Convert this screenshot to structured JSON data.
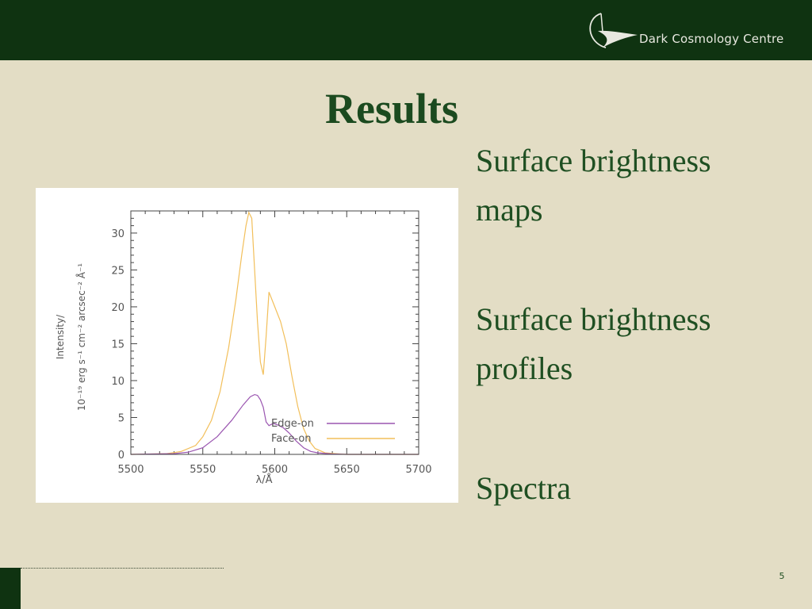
{
  "header": {
    "brand": "Dark Cosmology Centre",
    "logo_icon": "dark-cosmology-logo-icon"
  },
  "slide": {
    "title": "Results",
    "bullets": [
      {
        "line1": "Surface brightness",
        "line2": "maps"
      },
      {
        "line1": "Surface brightness",
        "line2": "profiles"
      },
      {
        "line1": "Spectra",
        "line2": ""
      }
    ],
    "page_number": "5"
  },
  "colors": {
    "header_bg": "#0f3311",
    "background": "#e3ddc5",
    "text": "#1f4f22",
    "edge_on": "#9a55b0",
    "face_on": "#f2bf5a"
  },
  "chart_data": {
    "type": "line",
    "xlabel": "λ/Å",
    "ylabel_line1": "Intensity/",
    "ylabel_line2": "10⁻¹⁹ erg s⁻¹ cm⁻² arcsec⁻² Å⁻¹",
    "xlim": [
      5500,
      5700
    ],
    "ylim": [
      0,
      33
    ],
    "xticks": [
      5500,
      5550,
      5600,
      5650,
      5700
    ],
    "yticks": [
      0,
      5,
      10,
      15,
      20,
      25,
      30
    ],
    "legend_position": "top-right",
    "series": [
      {
        "name": "Edge-on",
        "color": "#9a55b0",
        "x": [
          5500,
          5530,
          5540,
          5550,
          5560,
          5570,
          5578,
          5583,
          5586,
          5588,
          5590,
          5592,
          5594,
          5596,
          5599,
          5602,
          5606,
          5610,
          5615,
          5620,
          5625,
          5630,
          5640,
          5650,
          5700
        ],
        "y": [
          0,
          0.1,
          0.3,
          0.9,
          2.4,
          4.6,
          6.7,
          7.8,
          8.1,
          8.0,
          7.4,
          6.4,
          4.4,
          3.9,
          4.2,
          4.0,
          3.6,
          2.9,
          1.8,
          0.9,
          0.4,
          0.2,
          0.05,
          0,
          0
        ]
      },
      {
        "name": "Face-on",
        "color": "#f2bf5a",
        "x": [
          5500,
          5525,
          5535,
          5545,
          5550,
          5556,
          5562,
          5568,
          5573,
          5577,
          5580,
          5582,
          5584,
          5586,
          5588,
          5590,
          5592,
          5594,
          5596,
          5600,
          5604,
          5608,
          5612,
          5616,
          5620,
          5624,
          5628,
          5635,
          5645,
          5650,
          5700
        ],
        "y": [
          0,
          0.1,
          0.4,
          1.2,
          2.4,
          4.6,
          8.5,
          14.5,
          21.0,
          27.0,
          31.0,
          32.8,
          32.0,
          25.0,
          18.0,
          12.5,
          10.8,
          16.0,
          22.0,
          20.0,
          18.0,
          15.0,
          10.5,
          6.5,
          3.5,
          1.8,
          0.8,
          0.2,
          0.05,
          0,
          0
        ]
      }
    ]
  }
}
